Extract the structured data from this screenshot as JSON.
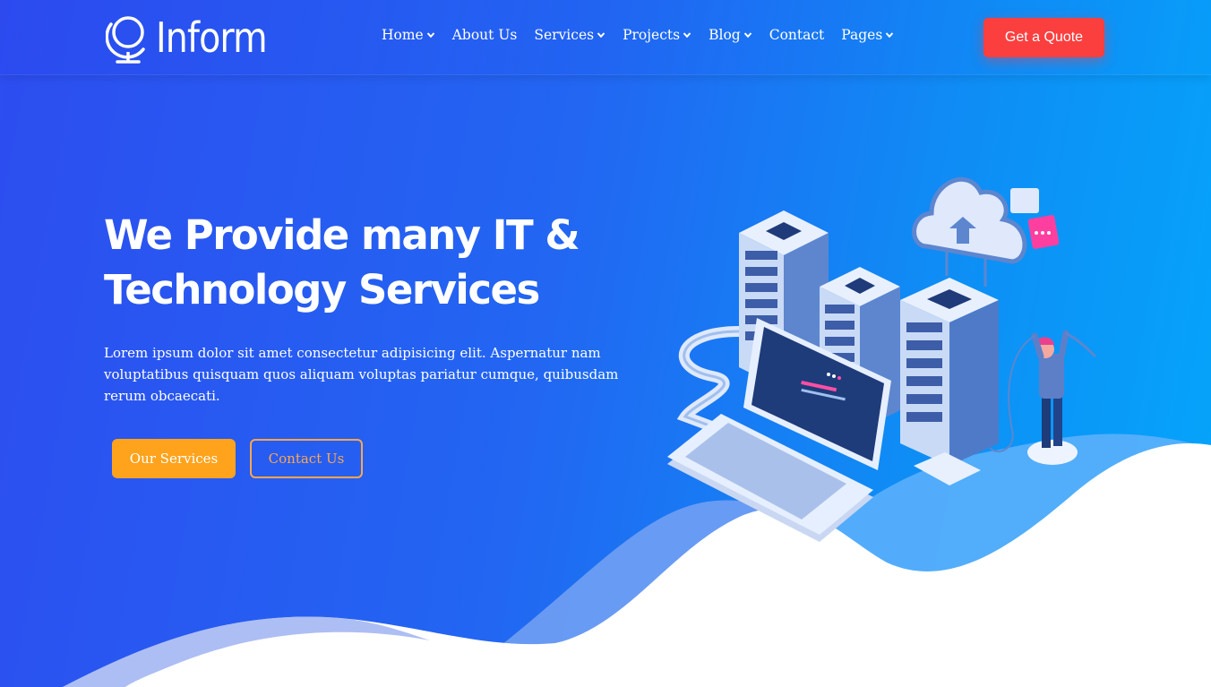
{
  "brand": {
    "name": "Inform",
    "icon": "globe-icon"
  },
  "nav": {
    "items": [
      {
        "label": "Home",
        "dropdown": true
      },
      {
        "label": "About Us",
        "dropdown": false
      },
      {
        "label": "Services",
        "dropdown": true
      },
      {
        "label": "Projects",
        "dropdown": true
      },
      {
        "label": "Blog",
        "dropdown": true
      },
      {
        "label": "Contact",
        "dropdown": false
      },
      {
        "label": "Pages",
        "dropdown": true
      }
    ],
    "cta_label": "Get a Quote"
  },
  "hero": {
    "title_line1": "We Provide many IT &",
    "title_line2": "Technology Services",
    "description": "Lorem ipsum dolor sit amet consectetur adipisicing elit. Aspernatur nam voluptatibus quisquam quos aliquam voluptas pariatur cumque, quibusdam rerum obcaecati.",
    "primary_button": "Our Services",
    "secondary_button": "Contact Us"
  },
  "colors": {
    "primary_button": "#ffa31d",
    "quote_button": "#fb3f3f",
    "background_start": "#2d4df0",
    "background_end": "#04a6fb"
  }
}
